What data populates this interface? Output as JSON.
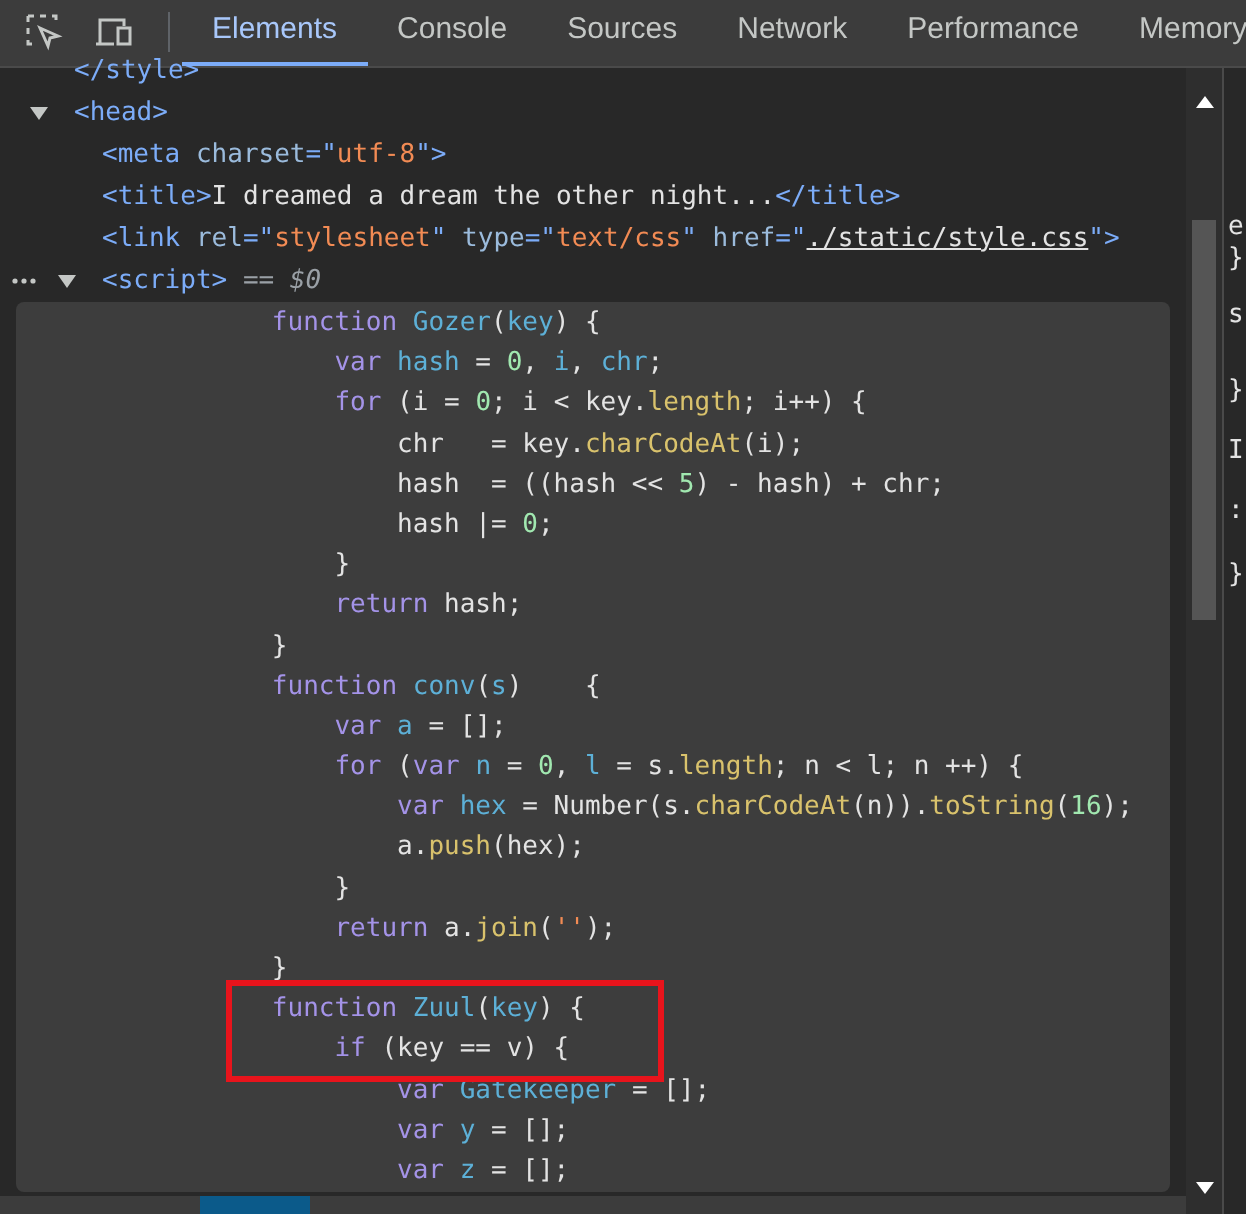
{
  "tabs": [
    {
      "label": "Elements",
      "selected": true
    },
    {
      "label": "Console",
      "selected": false
    },
    {
      "label": "Sources",
      "selected": false
    },
    {
      "label": "Network",
      "selected": false
    },
    {
      "label": "Performance",
      "selected": false
    },
    {
      "label": "Memory",
      "selected": false
    }
  ],
  "tree": [
    {
      "selected": false,
      "tokens": [
        {
          "kind": "tag",
          "text": "</style>"
        }
      ]
    },
    {
      "selected": false,
      "expanded": true,
      "tokens": [
        {
          "kind": "tag",
          "text": "<head>"
        }
      ],
      "children": [
        {
          "selected": false,
          "tokens": [
            {
              "kind": "tag",
              "text": "<meta "
            },
            {
              "kind": "attr",
              "text": "charset"
            },
            {
              "kind": "tag",
              "text": "=\""
            },
            {
              "kind": "val",
              "text": "utf-8"
            },
            {
              "kind": "tag",
              "text": "\">"
            }
          ]
        },
        {
          "selected": false,
          "tokens": [
            {
              "kind": "tag",
              "text": "<title>"
            },
            {
              "kind": "text",
              "text": "I dreamed a dream the other night..."
            },
            {
              "kind": "tag",
              "text": "</title>"
            }
          ]
        },
        {
          "selected": false,
          "tokens": [
            {
              "kind": "tag",
              "text": "<link "
            },
            {
              "kind": "attr",
              "text": "rel"
            },
            {
              "kind": "tag",
              "text": "=\""
            },
            {
              "kind": "val",
              "text": "stylesheet"
            },
            {
              "kind": "tag",
              "text": "\" "
            },
            {
              "kind": "attr",
              "text": "type"
            },
            {
              "kind": "tag",
              "text": "=\""
            },
            {
              "kind": "val",
              "text": "text/css"
            },
            {
              "kind": "tag",
              "text": "\" "
            },
            {
              "kind": "attr",
              "text": "href"
            },
            {
              "kind": "tag",
              "text": "=\""
            },
            {
              "kind": "link",
              "text": "./static/style.css"
            },
            {
              "kind": "tag",
              "text": "\">"
            }
          ]
        },
        {
          "selected": true,
          "expanded": true,
          "tokens": [
            {
              "kind": "tag",
              "text": "<script>"
            },
            {
              "kind": "note",
              "text": " == $0"
            }
          ]
        }
      ]
    }
  ],
  "script_lines": [
    {
      "highlighted": false,
      "tokens": [
        {
          "kind": "kw",
          "text": "            function "
        },
        {
          "kind": "def",
          "text": "Gozer"
        },
        {
          "kind": "p",
          "text": "("
        },
        {
          "kind": "def",
          "text": "key"
        },
        {
          "kind": "p",
          "text": ") {"
        }
      ]
    },
    {
      "highlighted": false,
      "tokens": [
        {
          "kind": "kw",
          "text": "                var "
        },
        {
          "kind": "def",
          "text": "hash"
        },
        {
          "kind": "p",
          "text": " = "
        },
        {
          "kind": "num",
          "text": "0"
        },
        {
          "kind": "p",
          "text": ", "
        },
        {
          "kind": "def",
          "text": "i"
        },
        {
          "kind": "p",
          "text": ", "
        },
        {
          "kind": "def",
          "text": "chr"
        },
        {
          "kind": "p",
          "text": ";"
        }
      ]
    },
    {
      "highlighted": false,
      "tokens": [
        {
          "kind": "kw",
          "text": "                for "
        },
        {
          "kind": "p",
          "text": "(i = "
        },
        {
          "kind": "num",
          "text": "0"
        },
        {
          "kind": "p",
          "text": "; i < key."
        },
        {
          "kind": "prop",
          "text": "length"
        },
        {
          "kind": "p",
          "text": "; i++) {"
        }
      ]
    },
    {
      "highlighted": false,
      "tokens": [
        {
          "kind": "p",
          "text": "                    chr   = key."
        },
        {
          "kind": "prop",
          "text": "charCodeAt"
        },
        {
          "kind": "p",
          "text": "(i);"
        }
      ]
    },
    {
      "highlighted": false,
      "tokens": [
        {
          "kind": "p",
          "text": "                    hash  = ((hash << "
        },
        {
          "kind": "num",
          "text": "5"
        },
        {
          "kind": "p",
          "text": ") - hash) + chr;"
        }
      ]
    },
    {
      "highlighted": false,
      "tokens": [
        {
          "kind": "p",
          "text": "                    hash |= "
        },
        {
          "kind": "num",
          "text": "0"
        },
        {
          "kind": "p",
          "text": ";"
        }
      ]
    },
    {
      "highlighted": false,
      "tokens": [
        {
          "kind": "p",
          "text": "                }"
        }
      ]
    },
    {
      "highlighted": false,
      "tokens": [
        {
          "kind": "kw",
          "text": "                return "
        },
        {
          "kind": "p",
          "text": "hash;"
        }
      ]
    },
    {
      "highlighted": false,
      "tokens": [
        {
          "kind": "p",
          "text": "            }"
        }
      ]
    },
    {
      "highlighted": false,
      "tokens": [
        {
          "kind": "kw",
          "text": "            function "
        },
        {
          "kind": "def",
          "text": "conv"
        },
        {
          "kind": "p",
          "text": "("
        },
        {
          "kind": "def",
          "text": "s"
        },
        {
          "kind": "p",
          "text": ")    {"
        }
      ]
    },
    {
      "highlighted": false,
      "tokens": [
        {
          "kind": "kw",
          "text": "                var "
        },
        {
          "kind": "def",
          "text": "a"
        },
        {
          "kind": "p",
          "text": " = [];"
        }
      ]
    },
    {
      "highlighted": false,
      "tokens": [
        {
          "kind": "kw",
          "text": "                for "
        },
        {
          "kind": "p",
          "text": "("
        },
        {
          "kind": "kw",
          "text": "var "
        },
        {
          "kind": "def",
          "text": "n"
        },
        {
          "kind": "p",
          "text": " = "
        },
        {
          "kind": "num",
          "text": "0"
        },
        {
          "kind": "p",
          "text": ", "
        },
        {
          "kind": "def",
          "text": "l"
        },
        {
          "kind": "p",
          "text": " = s."
        },
        {
          "kind": "prop",
          "text": "length"
        },
        {
          "kind": "p",
          "text": "; n < l; n ++) {"
        }
      ]
    },
    {
      "highlighted": false,
      "tokens": [
        {
          "kind": "kw",
          "text": "                    var "
        },
        {
          "kind": "def",
          "text": "hex"
        },
        {
          "kind": "p",
          "text": " = Number(s."
        },
        {
          "kind": "prop",
          "text": "charCodeAt"
        },
        {
          "kind": "p",
          "text": "(n))."
        },
        {
          "kind": "prop",
          "text": "toString"
        },
        {
          "kind": "p",
          "text": "("
        },
        {
          "kind": "num",
          "text": "16"
        },
        {
          "kind": "p",
          "text": ");"
        }
      ]
    },
    {
      "highlighted": false,
      "tokens": [
        {
          "kind": "p",
          "text": "                    a."
        },
        {
          "kind": "prop",
          "text": "push"
        },
        {
          "kind": "p",
          "text": "(hex);"
        }
      ]
    },
    {
      "highlighted": false,
      "tokens": [
        {
          "kind": "p",
          "text": "                }"
        }
      ]
    },
    {
      "highlighted": false,
      "tokens": [
        {
          "kind": "kw",
          "text": "                return "
        },
        {
          "kind": "p",
          "text": "a."
        },
        {
          "kind": "prop",
          "text": "join"
        },
        {
          "kind": "p",
          "text": "("
        },
        {
          "kind": "str",
          "text": "''"
        },
        {
          "kind": "p",
          "text": ");"
        }
      ]
    },
    {
      "highlighted": false,
      "tokens": [
        {
          "kind": "p",
          "text": "            }"
        }
      ]
    },
    {
      "highlighted": true,
      "tokens": [
        {
          "kind": "kw",
          "text": "            function "
        },
        {
          "kind": "def",
          "text": "Zuul"
        },
        {
          "kind": "p",
          "text": "("
        },
        {
          "kind": "def",
          "text": "key"
        },
        {
          "kind": "p",
          "text": ") {"
        }
      ]
    },
    {
      "highlighted": true,
      "tokens": [
        {
          "kind": "kw",
          "text": "                if "
        },
        {
          "kind": "p",
          "text": "(key == v) {"
        }
      ]
    },
    {
      "highlighted": false,
      "tokens": [
        {
          "kind": "kw",
          "text": "                    var "
        },
        {
          "kind": "def",
          "text": "Gatekeeper"
        },
        {
          "kind": "p",
          "text": " = [];"
        }
      ]
    },
    {
      "highlighted": false,
      "tokens": [
        {
          "kind": "kw",
          "text": "                    var "
        },
        {
          "kind": "def",
          "text": "y"
        },
        {
          "kind": "p",
          "text": " = [];"
        }
      ]
    },
    {
      "highlighted": false,
      "tokens": [
        {
          "kind": "kw",
          "text": "                    var "
        },
        {
          "kind": "def",
          "text": "z"
        },
        {
          "kind": "p",
          "text": " = [];"
        }
      ]
    }
  ],
  "styles_pane": {
    "fragments": [
      "e",
      "}",
      "s",
      "}",
      "I",
      ":",
      "}"
    ]
  }
}
